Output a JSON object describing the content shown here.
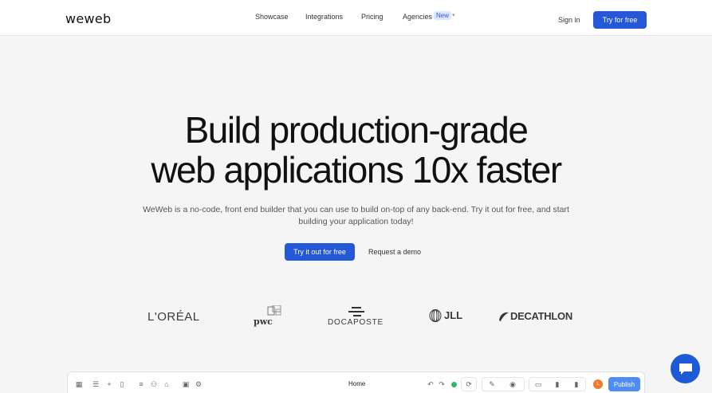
{
  "nav": {
    "logo": "weweb",
    "links": [
      "Showcase",
      "Integrations",
      "Pricing",
      "Agencies"
    ],
    "badge": "New",
    "signin": "Sign in",
    "cta": "Try for free"
  },
  "hero": {
    "title_line1": "Build production-grade",
    "title_line2": "web applications 10x faster",
    "subtitle": "WeWeb is a no-code, front end builder that you can use to build on-top of any back-end. Try it out for free, and start building your application today!",
    "cta_primary": "Try it out for free",
    "cta_secondary": "Request a demo"
  },
  "brands": {
    "loreal": "L'ORÉAL",
    "pwc": "pwc",
    "docaposte": "DOCAPOSTE",
    "jll": "JLL",
    "decathlon": "DECATHLON"
  },
  "editor": {
    "page": "Home",
    "avatar": "L",
    "publish": "Publish"
  },
  "colors": {
    "accent": "#2458d6",
    "publish": "#4f8df5",
    "status": "#2fb86f"
  }
}
